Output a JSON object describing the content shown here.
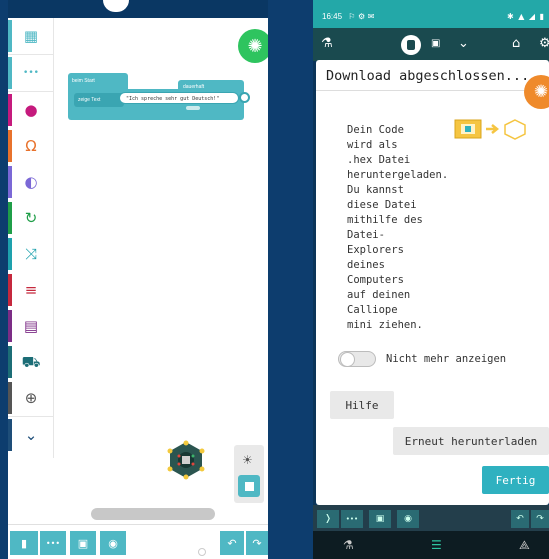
{
  "left_phone": {
    "block_start_label": "beim Start",
    "block_dauer_label": "dauerhaft",
    "block_command_label": "zeige Text",
    "block_text_value": "\"Ich spreche sehr gut Deutsch!\"",
    "categories": [
      {
        "icon": "grid-icon",
        "glyph": "▦",
        "color": "#4fb8c4"
      },
      {
        "icon": "more-icon",
        "glyph": "•••",
        "color": "#4fb8c4"
      },
      {
        "icon": "led-icon",
        "glyph": "●",
        "color": "#c51a7d"
      },
      {
        "icon": "headphones-icon",
        "glyph": "Ω",
        "color": "#e8722c"
      },
      {
        "icon": "toggle-icon",
        "glyph": "◐",
        "color": "#7b68d6"
      },
      {
        "icon": "loop-icon",
        "glyph": "↻",
        "color": "#1f9e48"
      },
      {
        "icon": "shuffle-icon",
        "glyph": "⤨",
        "color": "#1ea1ad"
      },
      {
        "icon": "list-icon",
        "glyph": "≡",
        "color": "#c5283d"
      },
      {
        "icon": "calculator-icon",
        "glyph": "▤",
        "color": "#7c2d86"
      },
      {
        "icon": "car-icon",
        "glyph": "⛟",
        "color": "#1c6d76"
      },
      {
        "icon": "plus-circle-icon",
        "glyph": "⊕",
        "color": "#555555"
      },
      {
        "icon": "chevron-down-icon",
        "glyph": "⌄",
        "color": "#1e4e79"
      }
    ],
    "bottom_buttons": {
      "file": "▮",
      "more": "•••",
      "save": "▣",
      "github": "◉",
      "undo": "↶",
      "redo": "↷"
    },
    "debug_glyph": "☀",
    "fab_glyph": "✺"
  },
  "right_phone": {
    "status_time": "16:45",
    "status_left_icons": "⚐ ⚙ ✉",
    "status_right_icons": "✱ ▲ ◢ ▮",
    "header_icons": {
      "left": "⚗",
      "grid": "▣",
      "chevron": "⌄",
      "home": "⌂",
      "gear": "⚙"
    },
    "modal": {
      "title": "Download abgeschlossen...",
      "close_glyph": "✺",
      "message": "Dein Code\nwird als\n.hex Datei\nheruntergeladen.\nDu kannst\ndiese Datei\nmithilfe des\nDatei-\nExplorers\ndeines\nComputers\nauf deinen\nCalliope\nmini ziehen.",
      "toggle_label": "Nicht mehr anzeigen",
      "help_button": "Hilfe",
      "redownload_button": "Erneut herunterladen",
      "done_button": "Fertig"
    },
    "nav_icons": {
      "back": "⚗",
      "home": "☰",
      "recent": "⟁"
    },
    "bottom_glyphs": {
      "b1": "❭",
      "b2": "•••",
      "b3": "▣",
      "b4": "◉",
      "b5": "↶",
      "b6": "↷"
    }
  }
}
